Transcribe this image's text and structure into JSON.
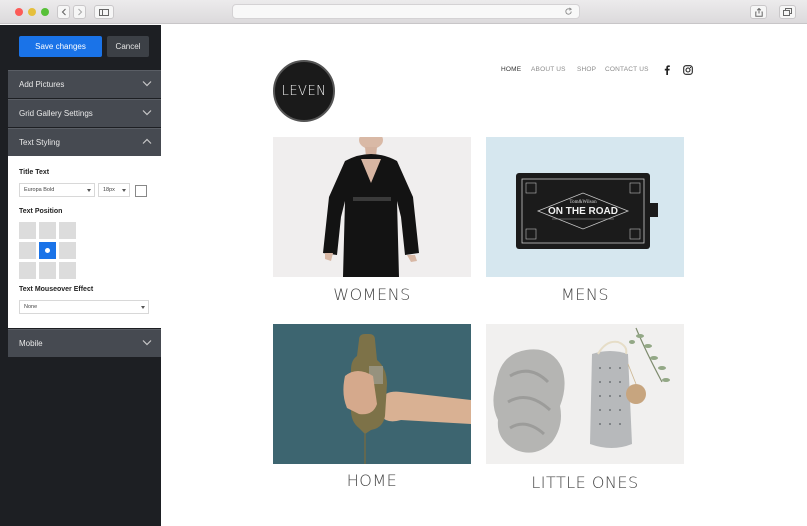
{
  "editor": {
    "save_label": "Save changes",
    "cancel_label": "Cancel",
    "sections": [
      {
        "label": "Add Pictures"
      },
      {
        "label": "Grid Gallery Settings"
      },
      {
        "label": "Text Styling"
      },
      {
        "label": "Mobile"
      }
    ],
    "title_text_label": "Title Text",
    "font_value": "Europa Bold",
    "size_value": "18px",
    "text_position_label": "Text Position",
    "mouseover_label": "Text Mouseover Effect",
    "mouseover_value": "None",
    "accent_color": "#1a73e8"
  },
  "site": {
    "logo_text": "LEVEN",
    "nav": [
      {
        "label": "HOME"
      },
      {
        "label": "ABOUT US"
      },
      {
        "label": "SHOP"
      },
      {
        "label": "CONTACT US"
      }
    ],
    "social_icons": [
      "facebook-icon",
      "instagram-icon"
    ],
    "product_box": {
      "brand": "Tom&Wilson",
      "title": "ON THE ROAD"
    },
    "gallery": [
      {
        "caption": "WOMENS"
      },
      {
        "caption": "MENS"
      },
      {
        "caption": "HOME"
      },
      {
        "caption": "LITTLE ONES"
      }
    ]
  }
}
